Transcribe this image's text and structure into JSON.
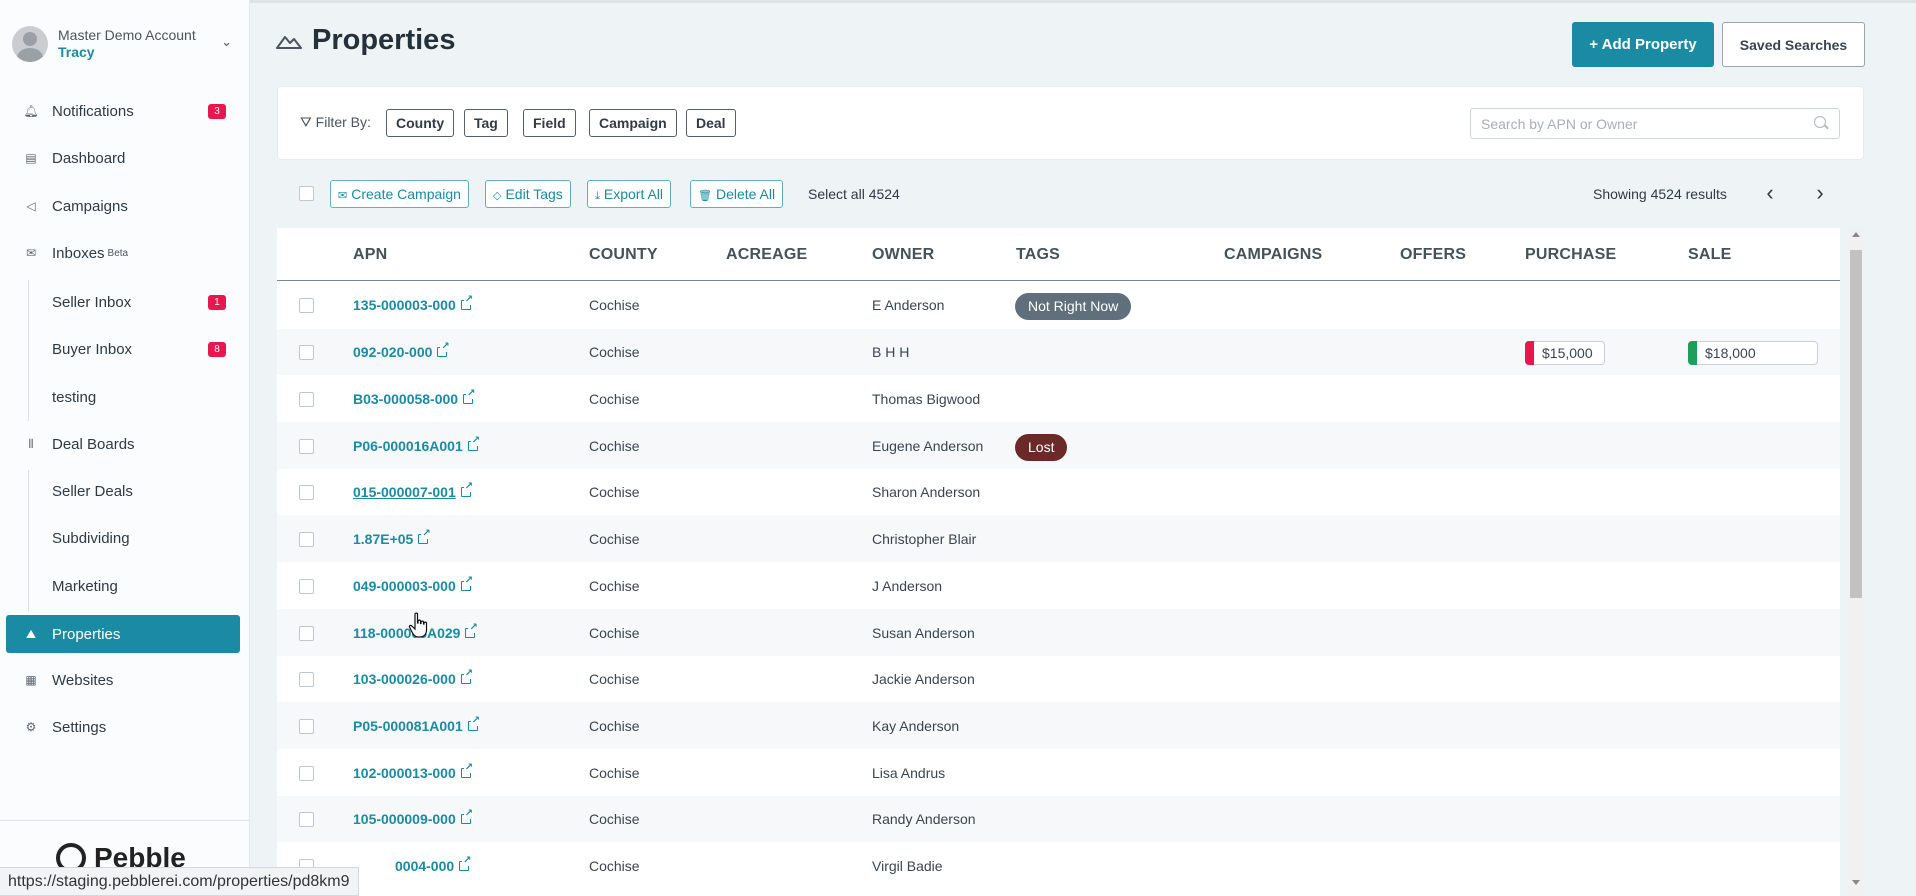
{
  "account": {
    "name": "Master Demo Account",
    "user": "Tracy"
  },
  "nav": {
    "notifications": {
      "label": "Notifications",
      "badge": "3"
    },
    "dashboard": {
      "label": "Dashboard"
    },
    "campaigns": {
      "label": "Campaigns"
    },
    "inboxes": {
      "label": "Inboxes",
      "beta": "Beta"
    },
    "seller_inbox": {
      "label": "Seller Inbox",
      "badge": "1"
    },
    "buyer_inbox": {
      "label": "Buyer Inbox",
      "badge": "8"
    },
    "testing": {
      "label": "testing"
    },
    "deal_boards": {
      "label": "Deal Boards"
    },
    "seller_deals": {
      "label": "Seller Deals"
    },
    "subdividing": {
      "label": "Subdividing"
    },
    "marketing": {
      "label": "Marketing"
    },
    "properties": {
      "label": "Properties"
    },
    "websites": {
      "label": "Websites"
    },
    "settings": {
      "label": "Settings"
    }
  },
  "brand": "Pebble",
  "status_url": "https://staging.pebblerei.com/properties/pd8km9",
  "header": {
    "title": "Properties",
    "add_label": "+ Add Property",
    "saved_label": "Saved Searches"
  },
  "filter": {
    "label": "Filter By:",
    "chips": [
      "County",
      "Tag",
      "Field",
      "Campaign",
      "Deal"
    ],
    "search_placeholder": "Search by APN or Owner"
  },
  "actions": {
    "create_campaign": "Create Campaign",
    "edit_tags": "Edit Tags",
    "export_all": "Export All",
    "delete_all": "Delete All",
    "select_all": "Select all 4524",
    "showing": "Showing 4524 results"
  },
  "columns": [
    "APN",
    "COUNTY",
    "ACREAGE",
    "OWNER",
    "TAGS",
    "CAMPAIGNS",
    "OFFERS",
    "PURCHASE",
    "SALE"
  ],
  "rows": [
    {
      "apn": "135-000003-000",
      "county": "Cochise",
      "owner": "E Anderson",
      "tag": "Not Right Now",
      "tag_color": "#5f6f7b"
    },
    {
      "apn": "092-020-000",
      "county": "Cochise",
      "owner": "B H H",
      "purchase": "$15,000",
      "purchase_color": "#e8184f",
      "sale": "$18,000",
      "sale_color": "#1e9e5b"
    },
    {
      "apn": "B03-000058-000",
      "county": "Cochise",
      "owner": "Thomas Bigwood"
    },
    {
      "apn": "P06-000016A001",
      "county": "Cochise",
      "owner": "Eugene Anderson",
      "tag": "Lost",
      "tag_color": "#6b2a28"
    },
    {
      "apn": "015-000007-001",
      "county": "Cochise",
      "owner": "Sharon Anderson"
    },
    {
      "apn": "1.87E+05",
      "county": "Cochise",
      "owner": "Christopher Blair"
    },
    {
      "apn": "049-000003-000",
      "county": "Cochise",
      "owner": "J Anderson"
    },
    {
      "apn": "118-000005A029",
      "county": "Cochise",
      "owner": "Susan Anderson"
    },
    {
      "apn": "103-000026-000",
      "county": "Cochise",
      "owner": "Jackie Anderson"
    },
    {
      "apn": "P05-000081A001",
      "county": "Cochise",
      "owner": "Kay Anderson"
    },
    {
      "apn": "102-000013-000",
      "county": "Cochise",
      "owner": "Lisa Andrus"
    },
    {
      "apn": "105-000009-000",
      "county": "Cochise",
      "owner": "Randy Anderson"
    },
    {
      "apn": "0004-000",
      "county": "Cochise",
      "owner": "Virgil Badie"
    }
  ],
  "colors": {
    "accent": "#1a8ba3",
    "badge": "#e8184f"
  }
}
